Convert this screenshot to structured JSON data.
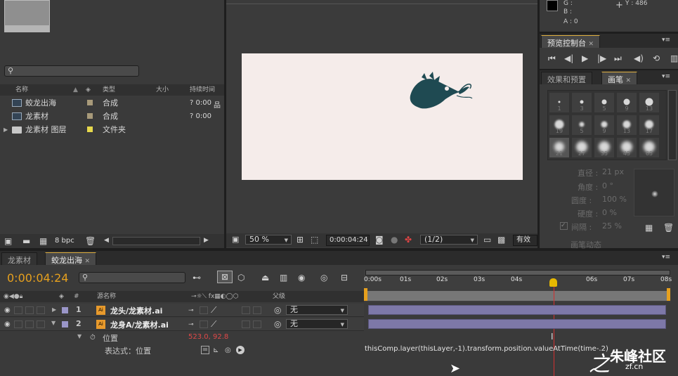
{
  "project": {
    "search_placeholder": "",
    "columns": [
      "名称",
      "类型",
      "大小",
      "持续时间"
    ],
    "items": [
      {
        "name": "蛟龙出海",
        "type": "合成",
        "duration": "? 0:00",
        "swatch": "#a89a7a"
      },
      {
        "name": "龙素材",
        "type": "合成",
        "duration": "? 0:00",
        "swatch": "#a89a7a"
      },
      {
        "name": "龙素材 图层",
        "type": "文件夹",
        "duration": "",
        "swatch": "#e6d84c"
      }
    ],
    "bpc": "8 bpc"
  },
  "viewer": {
    "zoom": "50 %",
    "timecode": "0:00:04:24",
    "resolution": "(1/2)",
    "extra": "有效"
  },
  "info": {
    "g": "G :",
    "b": "B :",
    "a": "A : 0",
    "y": "Y : 486"
  },
  "preview": {
    "tab": "预览控制台"
  },
  "brushes": {
    "tab_effects": "效果和预置",
    "tab_brushes": "画笔",
    "sizes": [
      "1",
      "3",
      "5",
      "9",
      "13",
      "19",
      "5",
      "9",
      "13",
      "17",
      "21",
      "27",
      "35",
      "45",
      "65"
    ],
    "diameter_label": "直径 :",
    "diameter_value": "21 px",
    "angle_label": "角度 :",
    "angle_value": "0 °",
    "roundness_label": "圆度 :",
    "roundness_value": "100 %",
    "hardness_label": "硬度 :",
    "hardness_value": "0 %",
    "spacing_label": "间隔 :",
    "spacing_value": "25 %",
    "dynamics": "画笔动态"
  },
  "timeline": {
    "tabs": [
      "龙素材",
      "蛟龙出海"
    ],
    "timecode": "0:00:04:24",
    "col_layer_name": "源名称",
    "col_parent": "父级",
    "col_num": "#",
    "ruler": [
      "0:00s",
      "01s",
      "02s",
      "03s",
      "04s",
      "06s",
      "07s",
      "08s"
    ],
    "layers": [
      {
        "num": "1",
        "name": "龙头/龙素材.ai",
        "parent": "无"
      },
      {
        "num": "2",
        "name": "龙身A/龙素材.ai",
        "parent": "无"
      }
    ],
    "property_name": "位置",
    "property_value": "523.0, 92.8",
    "expression_label": "表达式：位置",
    "expression_text": "thisComp.layer(thisLayer,-1).transform.position.valueAtTime(time-.2)"
  },
  "watermark": {
    "text": "朱峰社区",
    "sub": "zf.cn"
  }
}
